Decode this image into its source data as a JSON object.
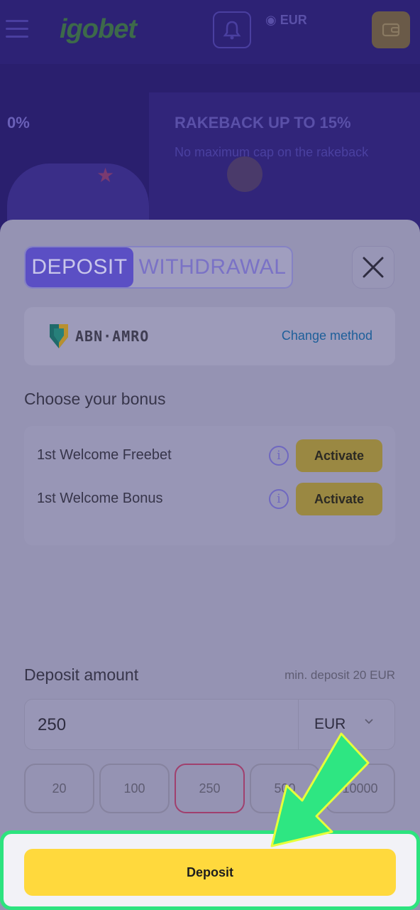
{
  "header": {
    "logo_text": "igobet",
    "balance_text": "EUR",
    "icons": [
      "menu-icon",
      "bell-icon",
      "wallet-icon"
    ]
  },
  "banner": {
    "left_text": "0%",
    "title": "RAKEBACK UP TO 15%",
    "subtitle": "No maximum cap on the rakeback"
  },
  "modal": {
    "tabs": [
      {
        "label": "DEPOSIT",
        "active": true
      },
      {
        "label": "WITHDRAWAL",
        "active": false
      }
    ],
    "close_icon": "close-icon",
    "method": {
      "bank_name": "ABN·AMRO",
      "change_label": "Change method"
    },
    "bonus": {
      "title": "Choose your bonus",
      "items": [
        {
          "label": "1st Welcome Freebet",
          "button": "Activate"
        },
        {
          "label": "1st Welcome Bonus",
          "button": "Activate"
        }
      ]
    },
    "amount": {
      "title": "Deposit amount",
      "min_text": "min. deposit 20 EUR",
      "value": "250",
      "currency": "EUR",
      "presets": [
        "20",
        "100",
        "250",
        "500",
        "10000"
      ],
      "selected_preset": "250"
    },
    "submit_label": "Deposit"
  },
  "colors": {
    "accent": "#5b4fc4",
    "deposit_button": "#ffd93d",
    "highlight": "#2de37f"
  }
}
